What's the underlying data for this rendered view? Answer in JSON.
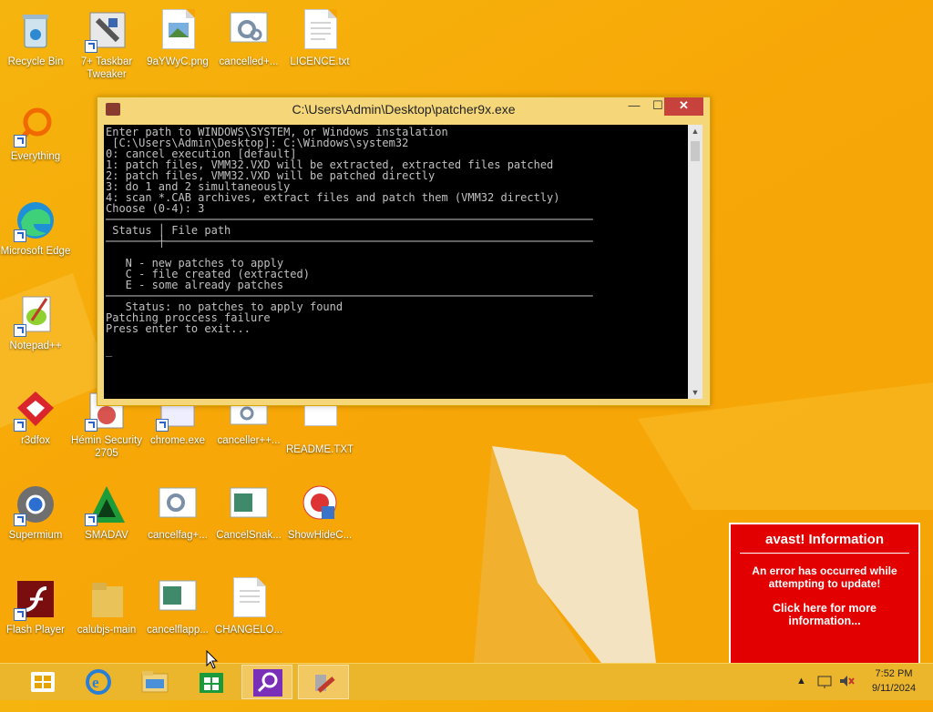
{
  "desktop": {
    "icons": [
      {
        "name": "recycle-bin",
        "label": "Recycle Bin"
      },
      {
        "name": "taskbar-tweaker",
        "label": "7+ Taskbar Tweaker"
      },
      {
        "name": "png-file",
        "label": "9aYWyC.png"
      },
      {
        "name": "cancelled-file",
        "label": "cancelled+..."
      },
      {
        "name": "licence-file",
        "label": "LICENCE.txt"
      },
      {
        "name": "everything",
        "label": "Everything"
      },
      {
        "name": "microsoft-edge",
        "label": "Microsoft Edge"
      },
      {
        "name": "notepad-plus-plus",
        "label": "Notepad++"
      },
      {
        "name": "r3dfox",
        "label": "r3dfox"
      },
      {
        "name": "hemin-security",
        "label": "Hémin Security 2705"
      },
      {
        "name": "chrome-exe",
        "label": "chrome.exe"
      },
      {
        "name": "canceller-file",
        "label": "canceller++..."
      },
      {
        "name": "readme-file",
        "label": "README.TXT"
      },
      {
        "name": "supermium",
        "label": "Supermium"
      },
      {
        "name": "smadav",
        "label": "SMADAV"
      },
      {
        "name": "cancelfag-file",
        "label": "cancelfag+..."
      },
      {
        "name": "cancelsnak-file",
        "label": "CancelSnak..."
      },
      {
        "name": "showhide-file",
        "label": "ShowHideC..."
      },
      {
        "name": "flash-player",
        "label": "Flash Player"
      },
      {
        "name": "calubjs-folder",
        "label": "calubjs-main"
      },
      {
        "name": "cancelflapp-file",
        "label": "cancelflapp..."
      },
      {
        "name": "changelog-file",
        "label": "CHANGELO..."
      }
    ]
  },
  "console_window": {
    "title": "C:\\Users\\Admin\\Desktop\\patcher9x.exe",
    "minimize": "—",
    "maximize": "☐",
    "close": "✕",
    "text": "Enter path to WINDOWS\\SYSTEM, or Windows instalation\n [C:\\Users\\Admin\\Desktop]: C:\\Windows\\system32\n0: cancel execution [default]\n1: patch files, VMM32.VXD will be extracted, extracted files patched\n2: patch files, VMM32.VXD will be patched directly\n3: do 1 and 2 simultaneously\n4: scan *.CAB archives, extract files and patch them (VMM32 directly)\nChoose (0-4): 3\n──────────────────────────────────────────────────────────────────────────\n Status │ File path\n────────┼─────────────────────────────────────────────────────────────────\n\n   N - new patches to apply\n   C - file created (extracted)\n   E - some already patches\n──────────────────────────────────────────────────────────────────────────\n   Status: no patches to apply found\nPatching proccess failure\nPress enter to exit...\n\n_"
  },
  "avast_popup": {
    "title": "avast! Information",
    "message": "An error has occurred while attempting to update!",
    "link": "Click here for more information..."
  },
  "taskbar": {
    "items": [
      {
        "name": "start-button"
      },
      {
        "name": "internet-explorer"
      },
      {
        "name": "file-explorer"
      },
      {
        "name": "windows-store"
      },
      {
        "name": "search"
      },
      {
        "name": "patcher9x"
      }
    ],
    "clock_time": "7:52 PM",
    "clock_date": "9/11/2024"
  },
  "colors": {
    "desktop": "#f6b40e",
    "taskbar": "#ecb62c",
    "avast": "#e20000",
    "console": "#000000",
    "close": "#c7423d"
  }
}
